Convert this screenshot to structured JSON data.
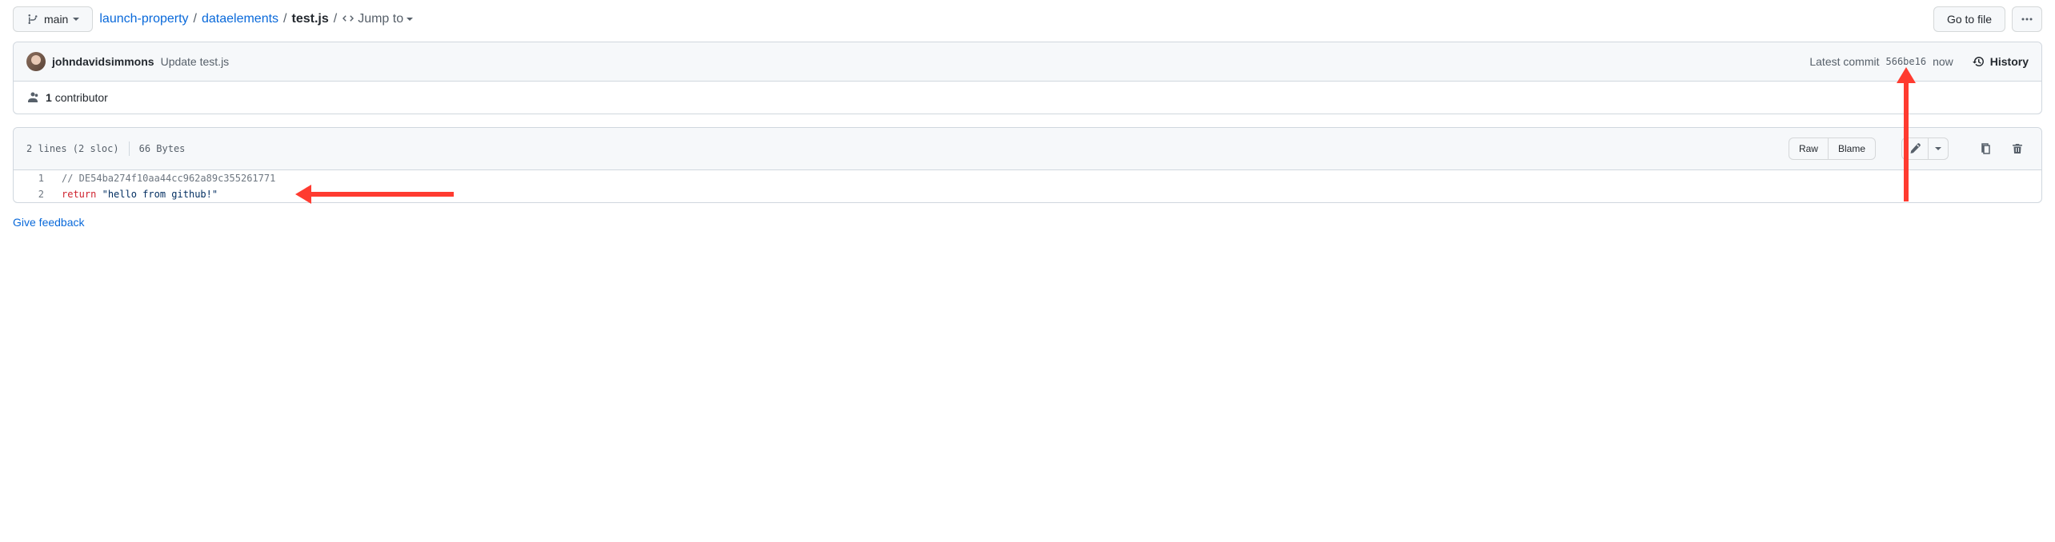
{
  "branch": {
    "name": "main"
  },
  "breadcrumb": {
    "repo": "launch-property",
    "folder": "dataelements",
    "file": "test.js",
    "jump": "Jump to"
  },
  "actions": {
    "go_to_file": "Go to file"
  },
  "commit": {
    "author": "johndavidsimmons",
    "message": "Update test.js",
    "latest_label": "Latest commit",
    "hash": "566be16",
    "time": "now",
    "history": "History"
  },
  "contributors": {
    "count": "1",
    "label": "contributor"
  },
  "file_meta": {
    "lines": "2 lines (2 sloc)",
    "size": "66 Bytes"
  },
  "toolbar": {
    "raw": "Raw",
    "blame": "Blame"
  },
  "code": {
    "lines": [
      {
        "num": "1",
        "comment": "// DE54ba274f10aa44cc962a89c355261771"
      },
      {
        "num": "2",
        "keyword": "return",
        "string": "\"hello from github!\""
      }
    ]
  },
  "feedback": "Give feedback"
}
